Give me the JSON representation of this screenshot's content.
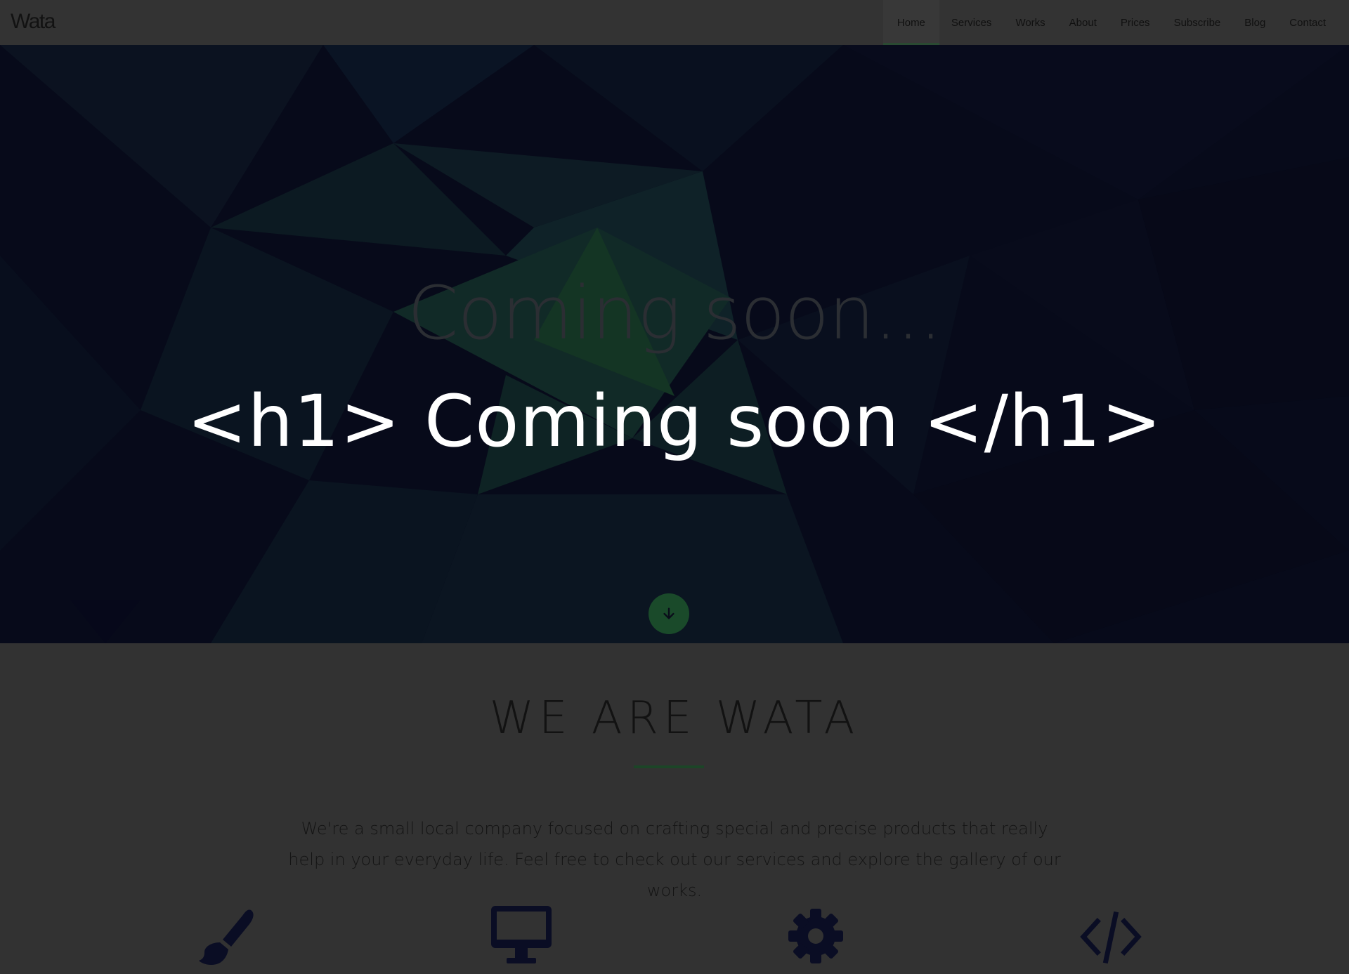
{
  "brand": "Wata",
  "nav": {
    "items": [
      {
        "label": "Home",
        "active": true
      },
      {
        "label": "Services"
      },
      {
        "label": "Works"
      },
      {
        "label": "About"
      },
      {
        "label": "Prices"
      },
      {
        "label": "Subscribe"
      },
      {
        "label": "Blog"
      },
      {
        "label": "Contact"
      }
    ]
  },
  "hero": {
    "subtitle": "Coming soon...",
    "title": "<h1> Coming soon </h1>",
    "scroll_icon": "arrow-down-icon"
  },
  "about": {
    "title": "WE ARE WATA",
    "text": "We're a small local company focused on crafting special and precise products that really help in your everyday life. Feel free to check out our services and explore the gallery of our works."
  },
  "services": {
    "icons": [
      "paint-brush-icon",
      "desktop-icon",
      "gear-icon",
      "code-icon"
    ]
  },
  "colors": {
    "accent": "#1a4a2a",
    "hero_bg": "#070a1a",
    "page_bg": "#323232",
    "icon": "#0a0d24"
  }
}
